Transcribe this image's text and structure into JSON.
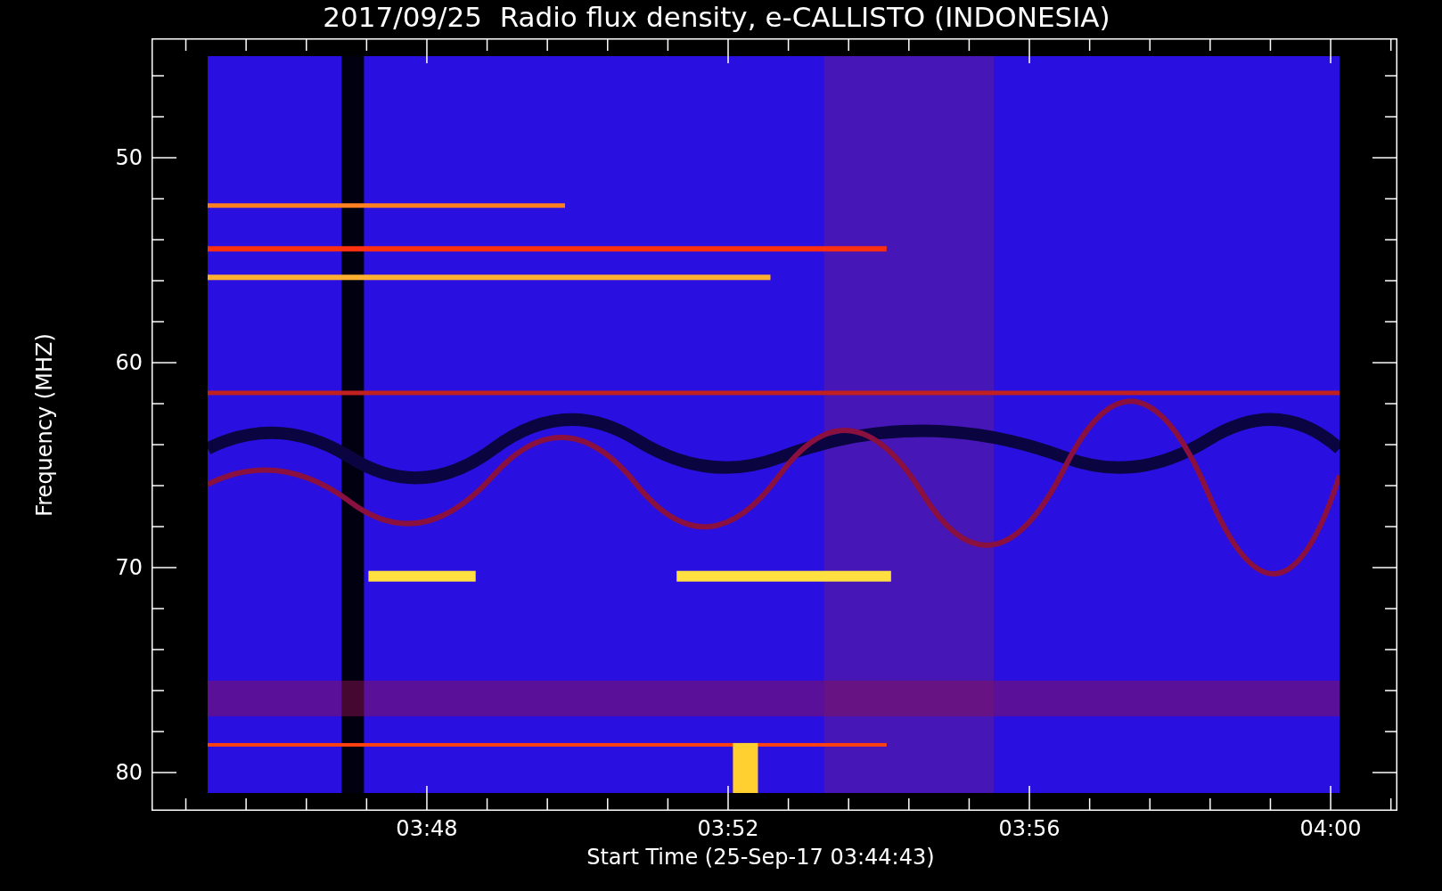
{
  "title": "2017/09/25  Radio flux density, e-CALLISTO (INDONESIA)",
  "plot": {
    "ylabel": "Frequency (MHZ)",
    "xlabel": "Start Time (25-Sep-17 03:44:43)",
    "yticks": [
      "50",
      "60",
      "70",
      "80"
    ],
    "xticks": [
      "03:48",
      "03:52",
      "03:56",
      "04:00"
    ]
  }
}
